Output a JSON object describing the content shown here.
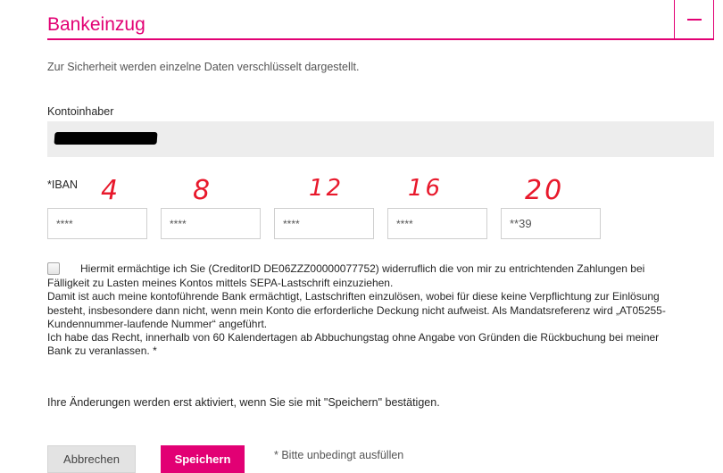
{
  "section": {
    "title": "Bankeinzug",
    "collapse_symbol": "−",
    "accent_color": "#e20074"
  },
  "security_note": "Zur Sicherheit werden einzelne Daten verschlüsselt dargestellt.",
  "account_holder": {
    "label": "Kontoinhaber",
    "value_redacted": true
  },
  "iban": {
    "label": "*IBAN",
    "fields": [
      "****",
      "****",
      "****",
      "****",
      "**39"
    ],
    "annotations": [
      "4",
      "8",
      "12",
      "16",
      "20"
    ],
    "annotation_color": "#e8192c"
  },
  "mandate": {
    "checked": false,
    "lines": [
      "Hiermit ermächtige ich Sie (CreditorID DE06ZZZ00000077752) widerruflich die von mir zu entrichtenden Zahlungen bei",
      "Fälligkeit zu Lasten meines Kontos mittels SEPA-Lastschrift einzuziehen.",
      "Damit ist auch meine kontoführende Bank ermächtigt, Lastschriften einzulösen, wobei für diese keine Verpflichtung zur Einlösung",
      "besteht, insbesondere dann nicht, wenn mein Konto die erforderliche Deckung nicht aufweist. Als Mandatsreferenz wird „AT05255-",
      "Kundennummer-laufende Nummer“ angeführt.",
      "Ich habe das Recht, innerhalb von 60 Kalendertagen ab Abbuchungstag ohne Angabe von Gründen die Rückbuchung bei meiner",
      "Bank zu veranlassen. *"
    ]
  },
  "activation_note": "Ihre Änderungen werden erst aktiviert, wenn Sie sie mit \"Speichern\" bestätigen.",
  "buttons": {
    "cancel": "Abbrechen",
    "save": "Speichern"
  },
  "required_note": "* Bitte unbedingt ausfüllen"
}
